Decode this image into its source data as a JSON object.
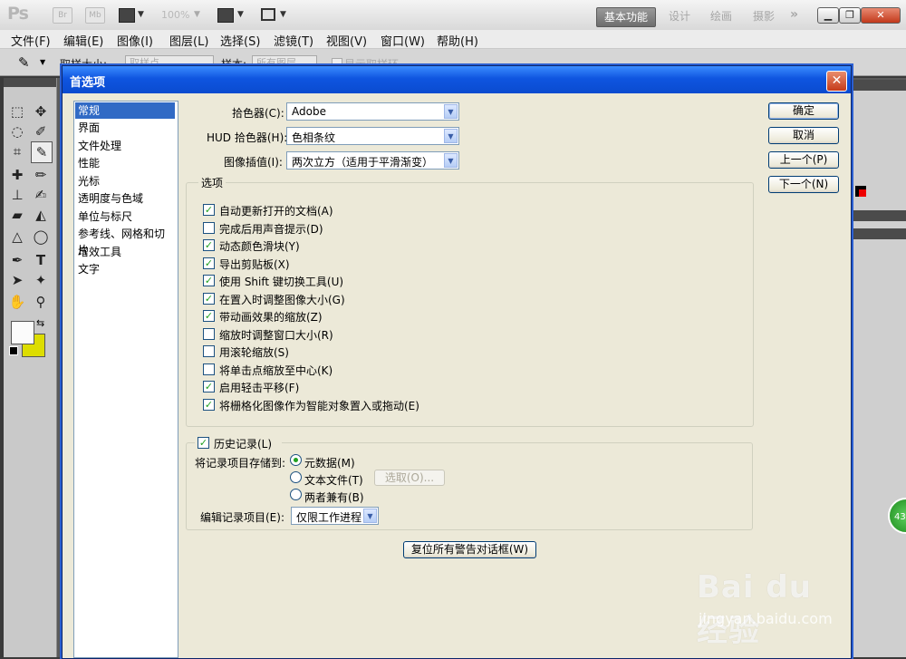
{
  "app": {
    "logo": "Ps",
    "zoom": "100%",
    "br_label": "Br",
    "mb_label": "Mb",
    "workspaces": [
      "基本功能",
      "设计",
      "绘画",
      "摄影"
    ],
    "more": "»"
  },
  "menu": [
    "文件(F)",
    "编辑(E)",
    "图像(I)",
    "图层(L)",
    "选择(S)",
    "滤镜(T)",
    "视图(V)",
    "窗口(W)",
    "帮助(H)"
  ],
  "options_bar": {
    "sample_size_label": "取样大小:",
    "sample_size_value": "取样点",
    "sample_label": "样本:",
    "sample_value": "所有图层",
    "show_ring_label": "显示取样环"
  },
  "colors": {
    "foreground": "#fbfbfb",
    "background": "#dddd00"
  },
  "badge": "43",
  "dialog": {
    "title": "首选项",
    "categories": [
      "常规",
      "界面",
      "文件处理",
      "性能",
      "光标",
      "透明度与色域",
      "单位与标尺",
      "参考线、网格和切片",
      "增效工具",
      "文字"
    ],
    "selected_category": "常规",
    "color_picker_label": "拾色器(C):",
    "color_picker_value": "Adobe",
    "hud_picker_label": "HUD 拾色器(H):",
    "hud_picker_value": "色相条纹",
    "interpolation_label": "图像插值(I):",
    "interpolation_value": "两次立方（适用于平滑渐变）",
    "options_title": "选项",
    "options": [
      {
        "label": "自动更新打开的文档(A)",
        "checked": true
      },
      {
        "label": "完成后用声音提示(D)",
        "checked": false
      },
      {
        "label": "动态颜色滑块(Y)",
        "checked": true
      },
      {
        "label": "导出剪贴板(X)",
        "checked": true
      },
      {
        "label": "使用 Shift 键切换工具(U)",
        "checked": true
      },
      {
        "label": "在置入时调整图像大小(G)",
        "checked": true
      },
      {
        "label": "带动画效果的缩放(Z)",
        "checked": true
      },
      {
        "label": "缩放时调整窗口大小(R)",
        "checked": false
      },
      {
        "label": "用滚轮缩放(S)",
        "checked": false
      },
      {
        "label": "将单击点缩放至中心(K)",
        "checked": false
      },
      {
        "label": "启用轻击平移(F)",
        "checked": true
      },
      {
        "label": "将栅格化图像作为智能对象置入或拖动(E)",
        "checked": true
      }
    ],
    "history": {
      "title": "历史记录(L)",
      "checked": true,
      "save_to_label": "将记录项目存储到:",
      "save_options": [
        "元数据(M)",
        "文本文件(T)",
        "两者兼有(B)"
      ],
      "selected_save": "元数据(M)",
      "choose_button": "选取(O)...",
      "edit_log_label": "编辑记录项目(E):",
      "edit_log_value": "仅限工作进程"
    },
    "reset_warnings_button": "复位所有警告对话框(W)",
    "buttons": {
      "ok": "确定",
      "cancel": "取消",
      "prev": "上一个(P)",
      "next": "下一个(N)"
    }
  },
  "watermark": {
    "brand": "Bai du 经验",
    "url": "jingyan.baidu.com"
  }
}
